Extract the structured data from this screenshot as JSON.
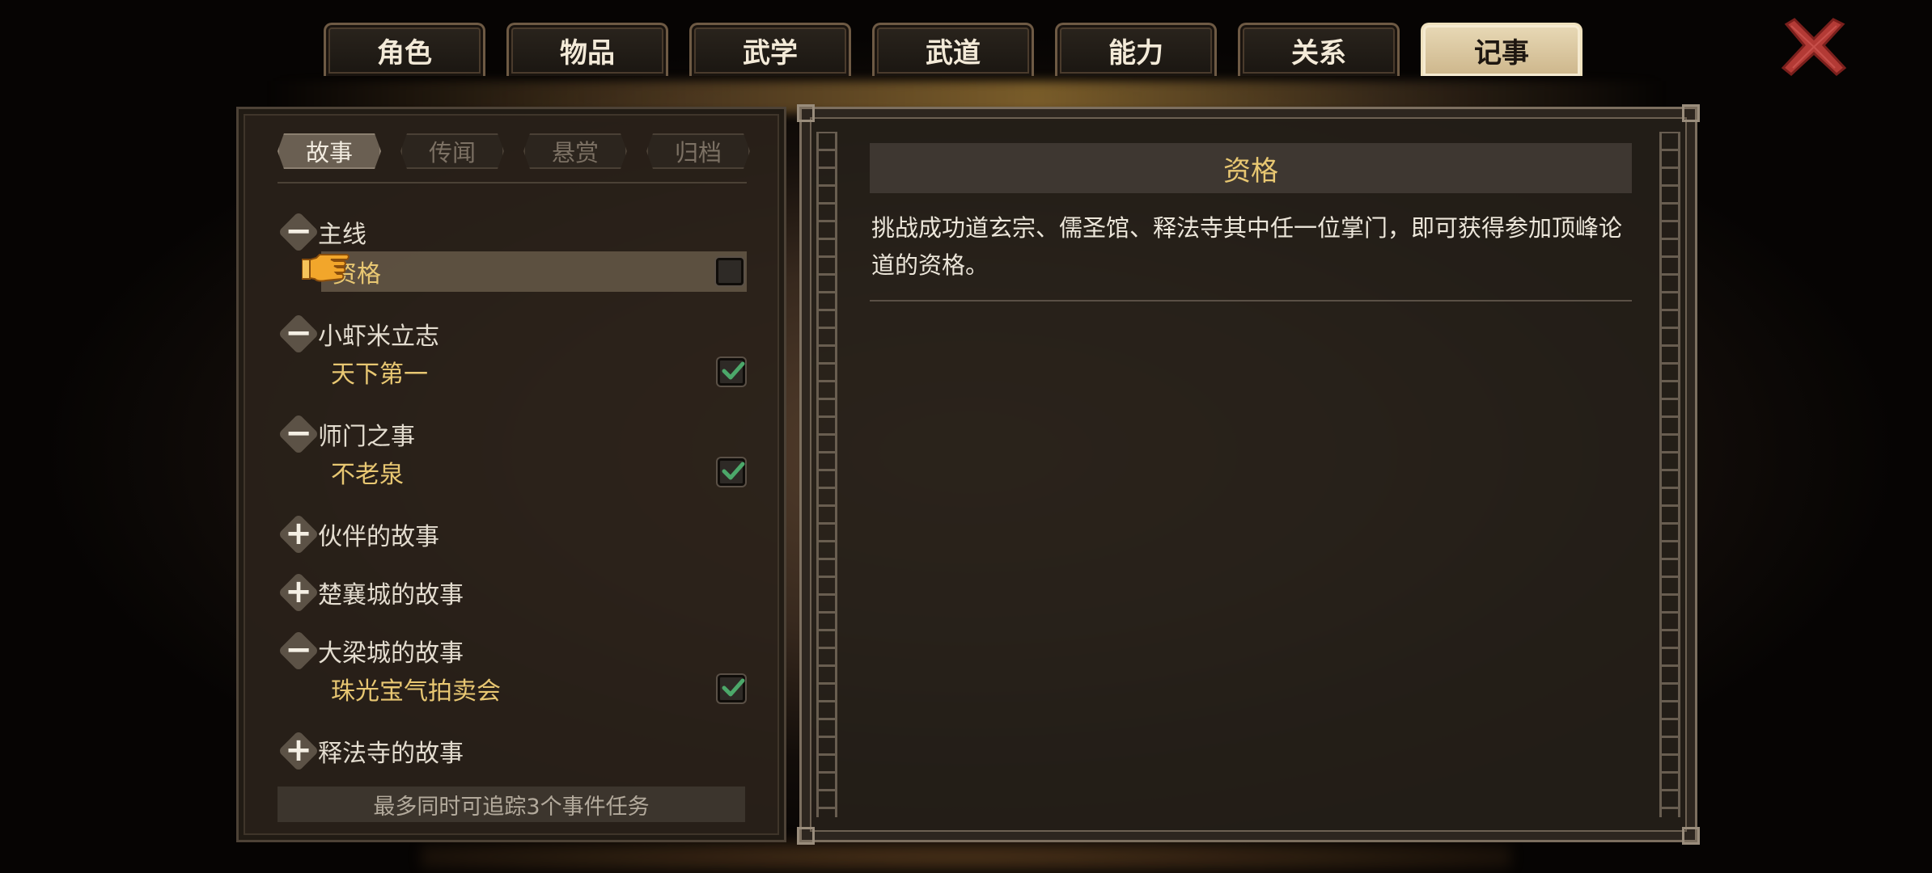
{
  "tabs": [
    {
      "label": "角色",
      "active": false
    },
    {
      "label": "物品",
      "active": false
    },
    {
      "label": "武学",
      "active": false
    },
    {
      "label": "武道",
      "active": false
    },
    {
      "label": "能力",
      "active": false
    },
    {
      "label": "关系",
      "active": false
    },
    {
      "label": "记事",
      "active": true
    }
  ],
  "close_icon": "close-x-icon",
  "subtabs": [
    {
      "label": "故事",
      "active": true
    },
    {
      "label": "传闻",
      "active": false
    },
    {
      "label": "悬赏",
      "active": false
    },
    {
      "label": "归档",
      "active": false
    }
  ],
  "categories": [
    {
      "label": "主线",
      "expanded": true,
      "sign": "−"
    },
    {
      "label": "小虾米立志",
      "expanded": true,
      "sign": "−"
    },
    {
      "label": "师门之事",
      "expanded": true,
      "sign": "−"
    },
    {
      "label": "伙伴的故事",
      "expanded": false,
      "sign": "+"
    },
    {
      "label": "楚襄城的故事",
      "expanded": false,
      "sign": "+"
    },
    {
      "label": "大梁城的故事",
      "expanded": true,
      "sign": "−"
    },
    {
      "label": "释法寺的故事",
      "expanded": false,
      "sign": "+"
    }
  ],
  "items": [
    {
      "label": "资格",
      "checked": false,
      "selected": true
    },
    {
      "label": "天下第一",
      "checked": true,
      "selected": false
    },
    {
      "label": "不老泉",
      "checked": true,
      "selected": false
    },
    {
      "label": "珠光宝气拍卖会",
      "checked": true,
      "selected": false
    }
  ],
  "footer_text": "最多同时可追踪3个事件任务",
  "detail": {
    "title": "资格",
    "description": "挑战成功道玄宗、儒圣馆、释法寺其中任一位掌门，即可获得参加顶峰论道的资格。"
  },
  "colors": {
    "accent_gold": "#e8c772",
    "active_tab": "#d9c59c",
    "check_green": "#4ca86a",
    "close_red": "#b33a35"
  }
}
